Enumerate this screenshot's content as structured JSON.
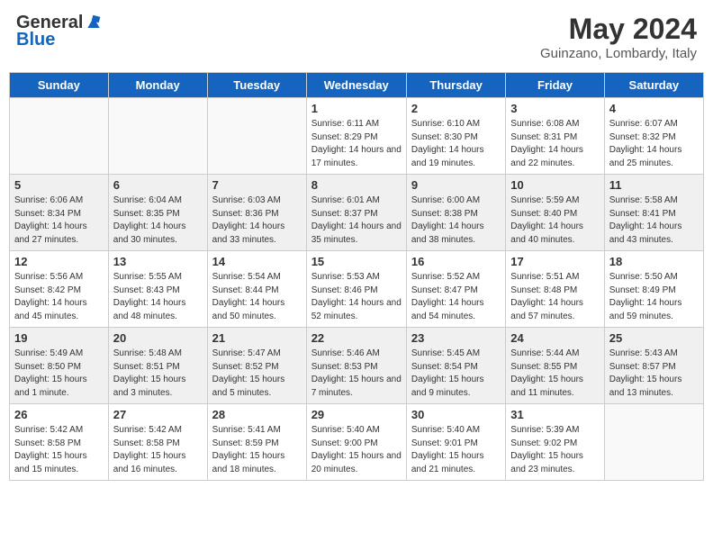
{
  "logo": {
    "general": "General",
    "blue": "Blue"
  },
  "header": {
    "month": "May 2024",
    "location": "Guinzano, Lombardy, Italy"
  },
  "days_of_week": [
    "Sunday",
    "Monday",
    "Tuesday",
    "Wednesday",
    "Thursday",
    "Friday",
    "Saturday"
  ],
  "weeks": [
    [
      {
        "day": "",
        "info": ""
      },
      {
        "day": "",
        "info": ""
      },
      {
        "day": "",
        "info": ""
      },
      {
        "day": "1",
        "info": "Sunrise: 6:11 AM\nSunset: 8:29 PM\nDaylight: 14 hours and 17 minutes."
      },
      {
        "day": "2",
        "info": "Sunrise: 6:10 AM\nSunset: 8:30 PM\nDaylight: 14 hours and 19 minutes."
      },
      {
        "day": "3",
        "info": "Sunrise: 6:08 AM\nSunset: 8:31 PM\nDaylight: 14 hours and 22 minutes."
      },
      {
        "day": "4",
        "info": "Sunrise: 6:07 AM\nSunset: 8:32 PM\nDaylight: 14 hours and 25 minutes."
      }
    ],
    [
      {
        "day": "5",
        "info": "Sunrise: 6:06 AM\nSunset: 8:34 PM\nDaylight: 14 hours and 27 minutes."
      },
      {
        "day": "6",
        "info": "Sunrise: 6:04 AM\nSunset: 8:35 PM\nDaylight: 14 hours and 30 minutes."
      },
      {
        "day": "7",
        "info": "Sunrise: 6:03 AM\nSunset: 8:36 PM\nDaylight: 14 hours and 33 minutes."
      },
      {
        "day": "8",
        "info": "Sunrise: 6:01 AM\nSunset: 8:37 PM\nDaylight: 14 hours and 35 minutes."
      },
      {
        "day": "9",
        "info": "Sunrise: 6:00 AM\nSunset: 8:38 PM\nDaylight: 14 hours and 38 minutes."
      },
      {
        "day": "10",
        "info": "Sunrise: 5:59 AM\nSunset: 8:40 PM\nDaylight: 14 hours and 40 minutes."
      },
      {
        "day": "11",
        "info": "Sunrise: 5:58 AM\nSunset: 8:41 PM\nDaylight: 14 hours and 43 minutes."
      }
    ],
    [
      {
        "day": "12",
        "info": "Sunrise: 5:56 AM\nSunset: 8:42 PM\nDaylight: 14 hours and 45 minutes."
      },
      {
        "day": "13",
        "info": "Sunrise: 5:55 AM\nSunset: 8:43 PM\nDaylight: 14 hours and 48 minutes."
      },
      {
        "day": "14",
        "info": "Sunrise: 5:54 AM\nSunset: 8:44 PM\nDaylight: 14 hours and 50 minutes."
      },
      {
        "day": "15",
        "info": "Sunrise: 5:53 AM\nSunset: 8:46 PM\nDaylight: 14 hours and 52 minutes."
      },
      {
        "day": "16",
        "info": "Sunrise: 5:52 AM\nSunset: 8:47 PM\nDaylight: 14 hours and 54 minutes."
      },
      {
        "day": "17",
        "info": "Sunrise: 5:51 AM\nSunset: 8:48 PM\nDaylight: 14 hours and 57 minutes."
      },
      {
        "day": "18",
        "info": "Sunrise: 5:50 AM\nSunset: 8:49 PM\nDaylight: 14 hours and 59 minutes."
      }
    ],
    [
      {
        "day": "19",
        "info": "Sunrise: 5:49 AM\nSunset: 8:50 PM\nDaylight: 15 hours and 1 minute."
      },
      {
        "day": "20",
        "info": "Sunrise: 5:48 AM\nSunset: 8:51 PM\nDaylight: 15 hours and 3 minutes."
      },
      {
        "day": "21",
        "info": "Sunrise: 5:47 AM\nSunset: 8:52 PM\nDaylight: 15 hours and 5 minutes."
      },
      {
        "day": "22",
        "info": "Sunrise: 5:46 AM\nSunset: 8:53 PM\nDaylight: 15 hours and 7 minutes."
      },
      {
        "day": "23",
        "info": "Sunrise: 5:45 AM\nSunset: 8:54 PM\nDaylight: 15 hours and 9 minutes."
      },
      {
        "day": "24",
        "info": "Sunrise: 5:44 AM\nSunset: 8:55 PM\nDaylight: 15 hours and 11 minutes."
      },
      {
        "day": "25",
        "info": "Sunrise: 5:43 AM\nSunset: 8:57 PM\nDaylight: 15 hours and 13 minutes."
      }
    ],
    [
      {
        "day": "26",
        "info": "Sunrise: 5:42 AM\nSunset: 8:58 PM\nDaylight: 15 hours and 15 minutes."
      },
      {
        "day": "27",
        "info": "Sunrise: 5:42 AM\nSunset: 8:58 PM\nDaylight: 15 hours and 16 minutes."
      },
      {
        "day": "28",
        "info": "Sunrise: 5:41 AM\nSunset: 8:59 PM\nDaylight: 15 hours and 18 minutes."
      },
      {
        "day": "29",
        "info": "Sunrise: 5:40 AM\nSunset: 9:00 PM\nDaylight: 15 hours and 20 minutes."
      },
      {
        "day": "30",
        "info": "Sunrise: 5:40 AM\nSunset: 9:01 PM\nDaylight: 15 hours and 21 minutes."
      },
      {
        "day": "31",
        "info": "Sunrise: 5:39 AM\nSunset: 9:02 PM\nDaylight: 15 hours and 23 minutes."
      },
      {
        "day": "",
        "info": ""
      }
    ]
  ]
}
